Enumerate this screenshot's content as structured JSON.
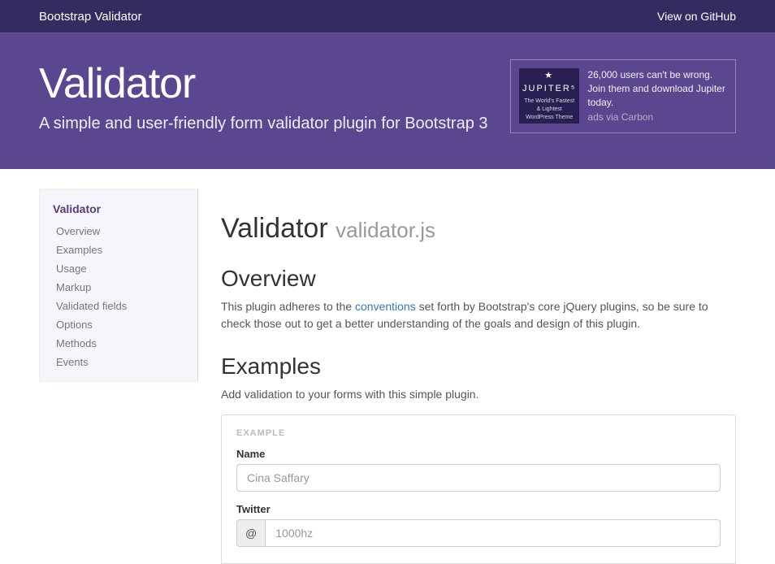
{
  "topbar": {
    "brand": "Bootstrap Validator",
    "github": "View on GitHub"
  },
  "hero": {
    "title": "Validator",
    "subtitle": "A simple and user-friendly form validator plugin for Bootstrap 3"
  },
  "ad": {
    "brand": "★ JUPITER⁵",
    "tagline": "The World's Fastest & Lightest WordPress Theme",
    "text": "26,000 users can't be wrong. Join them and download Jupiter today.",
    "via": "ads via Carbon"
  },
  "sidenav": {
    "title": "Validator",
    "items": [
      "Overview",
      "Examples",
      "Usage",
      "Markup",
      "Validated fields",
      "Options",
      "Methods",
      "Events"
    ]
  },
  "content": {
    "heading": "Validator",
    "heading_sub": "validator.js",
    "overview_h": "Overview",
    "overview_p1": "This plugin adheres to the ",
    "overview_link": "conventions",
    "overview_p2": " set forth by Bootstrap's core jQuery plugins, so be sure to check those out to get a better understanding of the goals and design of this plugin.",
    "examples_h": "Examples",
    "examples_p": "Add validation to your forms with this simple plugin.",
    "example_label": "EXAMPLE",
    "form": {
      "name_label": "Name",
      "name_placeholder": "Cina Saffary",
      "twitter_label": "Twitter",
      "twitter_addon": "@",
      "twitter_placeholder": "1000hz"
    }
  }
}
